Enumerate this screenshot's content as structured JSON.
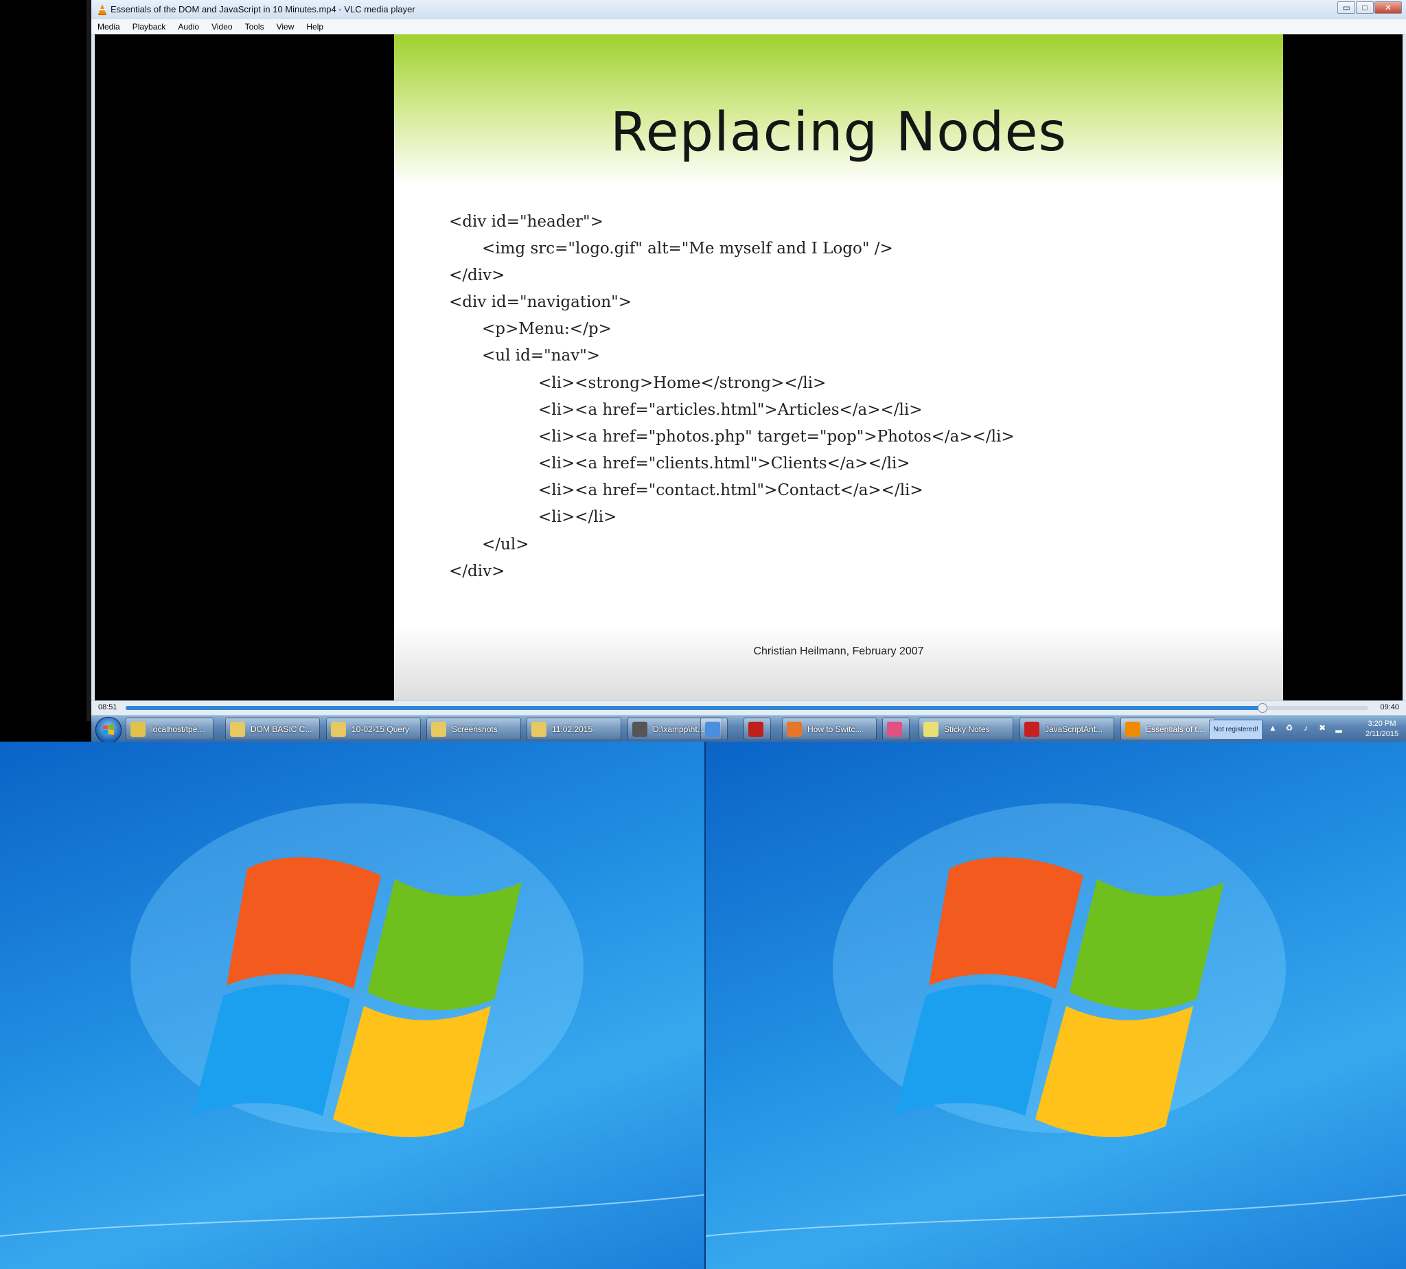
{
  "window": {
    "title": "Essentials of the DOM and JavaScript in 10 Minutes.mp4 - VLC media player",
    "buttons": {
      "minimize": "▭",
      "maximize": "□",
      "close": "✕"
    }
  },
  "menu": [
    "Media",
    "Playback",
    "Audio",
    "Video",
    "Tools",
    "View",
    "Help"
  ],
  "slide": {
    "title": "Replacing Nodes",
    "code_lines": [
      "<div id=\"header\">",
      "<img src=\"logo.gif\" alt=\"Me myself and I Logo\" />",
      "</div>",
      "<div id=\"navigation\">",
      "<p>Menu:</p>",
      "<ul id=\"nav\">",
      "<li><strong>Home</strong></li>",
      "<li><a href=\"articles.html\">Articles</a></li>",
      "<li><a href=\"photos.php\" target=\"pop\">Photos</a></li>",
      "<li><a href=\"clients.html\">Clients</a></li>",
      "<li><a href=\"contact.html\">Contact</a></li>",
      "<li></li>",
      "</ul>",
      "</div>"
    ],
    "footer": "Christian Heilmann, February 2007"
  },
  "playback": {
    "elapsed": "08:51",
    "total": "09:40",
    "progress": 0.915
  },
  "taskbar": {
    "tasks": [
      {
        "label": "localhost/tpe...",
        "icon": "chrome-icon",
        "color": "#e2c34a"
      },
      {
        "label": "DOM BASIC C...",
        "icon": "folder-icon",
        "color": "#e8c860"
      },
      {
        "label": "10-02-15 Query",
        "icon": "folder-icon",
        "color": "#e8c860"
      },
      {
        "label": "Screenshots",
        "icon": "folder-icon",
        "color": "#e8c860"
      },
      {
        "label": "11.02.2015",
        "icon": "folder-icon",
        "color": "#e8c860"
      },
      {
        "label": "D:\\xampp\\ht...",
        "icon": "sublime-icon",
        "color": "#555555"
      },
      {
        "label": "",
        "icon": "media-icon",
        "color": "#4a8fe0"
      },
      {
        "label": "",
        "icon": "filezilla-icon",
        "color": "#c0201a"
      },
      {
        "label": "How to Switc...",
        "icon": "firefox-icon",
        "color": "#e8752a"
      },
      {
        "label": "",
        "icon": "pinwheel-icon",
        "color": "#e05080"
      },
      {
        "label": "Sticky Notes",
        "icon": "sticky-notes-icon",
        "color": "#e8e070"
      },
      {
        "label": "JavaScriptAnt...",
        "icon": "pdf-icon",
        "color": "#c82020"
      },
      {
        "label": "Essentials of t...",
        "icon": "vlc-icon",
        "color": "#f08a00"
      }
    ],
    "not_registered": "Not registered!",
    "tray_icons": [
      "up-arrow-icon",
      "sync-icon",
      "volume-icon",
      "network-icon",
      "signal-icon"
    ],
    "time": "3:20 PM",
    "date": "2/11/2015"
  },
  "colors": {
    "accent": "#2f87d6",
    "slide_green": "#9fd12e"
  }
}
